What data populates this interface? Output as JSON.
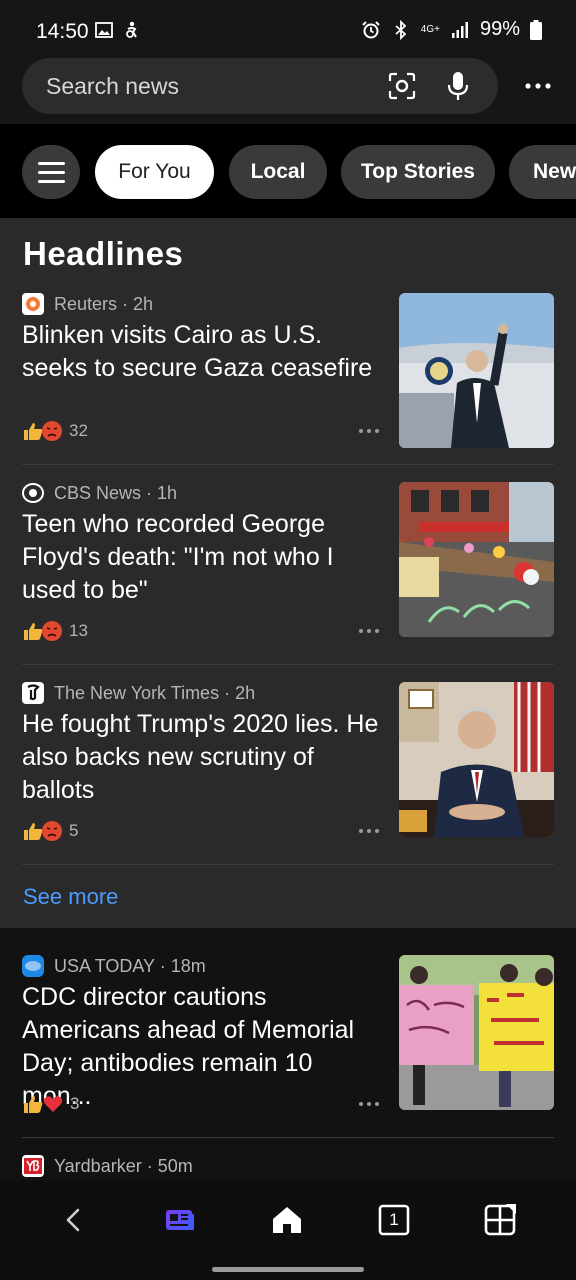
{
  "status_bar": {
    "time": "14:50",
    "battery": "99%",
    "network": "4G+"
  },
  "search": {
    "placeholder": "Search news"
  },
  "tabs": [
    {
      "label": "For You",
      "active": true
    },
    {
      "label": "Local",
      "active": false
    },
    {
      "label": "Top Stories",
      "active": false
    },
    {
      "label": "New",
      "active": false
    }
  ],
  "headlines": {
    "title": "Headlines",
    "articles": [
      {
        "source": "Reuters · 2h",
        "headline": "Blinken visits Cairo as U.S. seeks to secure Gaza ceasefire",
        "reactions": "32",
        "reaction_icons": [
          "thumbs-up",
          "angry-face"
        ]
      },
      {
        "source": "CBS News · 1h",
        "headline": "Teen who recorded George Floyd's death: \"I'm not who I used to be\"",
        "reactions": "13",
        "reaction_icons": [
          "thumbs-up",
          "angry-face"
        ]
      },
      {
        "source": "The New York Times · 2h",
        "headline": "He fought Trump's 2020 lies. He also backs new scrutiny of ballots",
        "reactions": "5",
        "reaction_icons": [
          "thumbs-up",
          "angry-face"
        ]
      }
    ],
    "see_more": "See more"
  },
  "feed": [
    {
      "source": "USA TODAY · 18m",
      "headline": "CDC director cautions Americans ahead of Memorial Day; antibodies remain 10 mon...",
      "reactions": "3",
      "reaction_icons": [
        "thumbs-up",
        "heart"
      ]
    },
    {
      "source": "Yardbarker · 50m"
    }
  ],
  "nav": [
    "back-icon",
    "news-feed-icon",
    "home-icon",
    "tabs-icon",
    "apps-icon"
  ],
  "nav_tab_count": "1",
  "colors": {
    "link": "#4a9bff",
    "card": "#2a2a2a",
    "background": "#121212"
  }
}
